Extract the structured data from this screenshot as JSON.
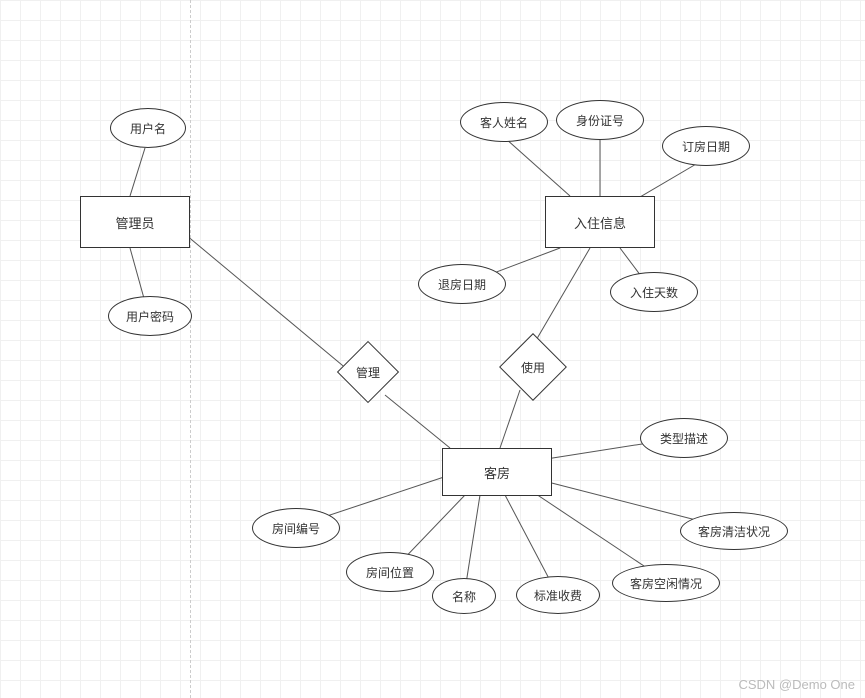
{
  "entities": {
    "admin": "管理员",
    "checkin": "入住信息",
    "room": "客房"
  },
  "relations": {
    "manage": "管理",
    "use": "使用"
  },
  "attrs": {
    "username": "用户名",
    "userpwd": "用户密码",
    "guest_name": "客人姓名",
    "id_number": "身份证号",
    "booking_date": "订房日期",
    "checkout_date": "退房日期",
    "stay_days": "入住天数",
    "room_no": "房间编号",
    "room_loc": "房间位置",
    "name": "名称",
    "std_fee": "标准收费",
    "type_desc": "类型描述",
    "clean_status": "客房清洁状况",
    "idle_status": "客房空闲情况"
  },
  "watermark": "CSDN @Demo One"
}
